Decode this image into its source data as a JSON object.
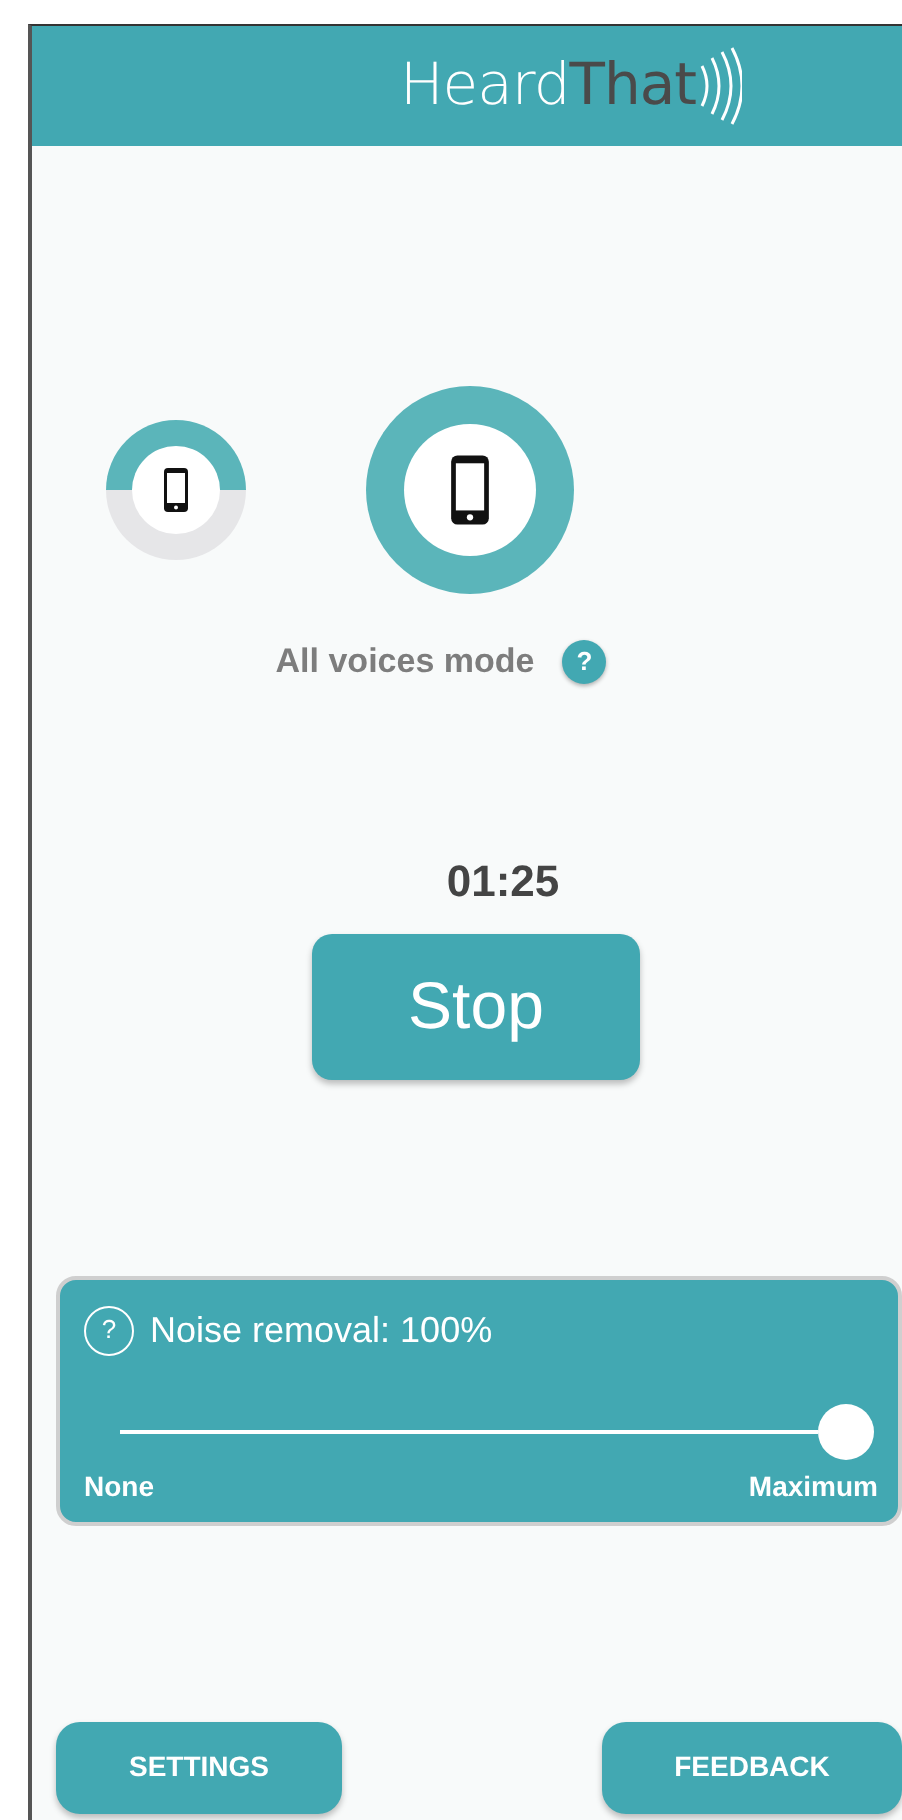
{
  "header": {
    "logo_light": "Heard",
    "logo_dark": "That"
  },
  "modes": [
    {
      "selected": false
    },
    {
      "selected": true
    }
  ],
  "mode_label": "All voices mode",
  "mode_help": "?",
  "timer": "01:25",
  "stop_button": "Stop",
  "noise_panel": {
    "help": "?",
    "label": "Noise removal:  100%",
    "level": 1,
    "min_label": "None",
    "max_label": "Maximum"
  },
  "buttons": [
    "SETTINGS",
    "FEEDBACK"
  ]
}
